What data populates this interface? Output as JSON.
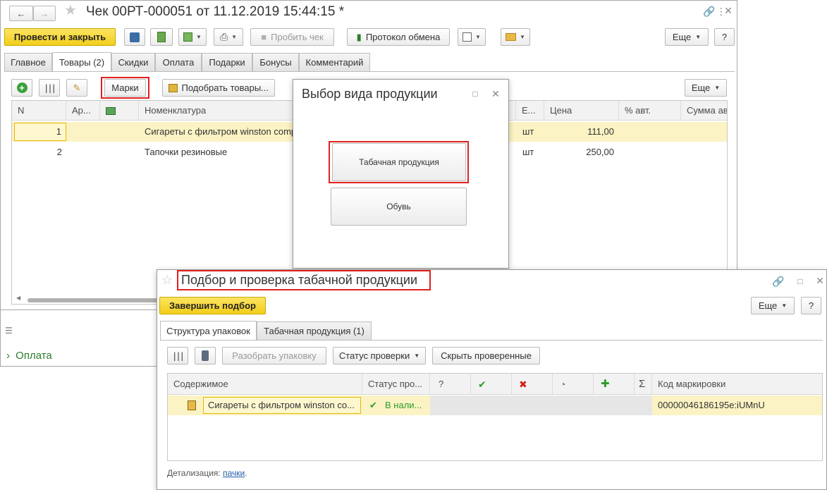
{
  "main_window": {
    "title": "Чек 00РТ-000051 от 11.12.2019 15:44:15 *",
    "nav_back": "←",
    "nav_forward": "→",
    "toolbar": {
      "post_close": "Провести и закрыть",
      "punch_receipt": "Пробить чек",
      "exchange_log": "Протокол обмена",
      "more": "Еще",
      "help": "?"
    },
    "tabs": [
      "Главное",
      "Товары (2)",
      "Скидки",
      "Оплата",
      "Подарки",
      "Бонусы",
      "Комментарий"
    ],
    "goods_toolbar": {
      "marks": "Марки",
      "select_goods": "Подобрать товары...",
      "more": "Еще"
    },
    "columns": [
      "N",
      "Ар...",
      "",
      "Номенклатура",
      "Е...",
      "Цена",
      "% авт.",
      "Сумма ав"
    ],
    "rows": [
      {
        "n": "1",
        "name": "Сигареты с фильтром winston comp",
        "unit": "шт",
        "price": "111,00"
      },
      {
        "n": "2",
        "name": "Тапочки резиновые",
        "unit": "шт",
        "price": "250,00"
      }
    ],
    "payment_link": "Оплата"
  },
  "dialog_product_type": {
    "title": "Выбор вида продукции",
    "options": [
      "Табачная продукция",
      "Обувь"
    ]
  },
  "tobacco_window": {
    "title": "Подбор и проверка табачной продукции",
    "finish": "Завершить подбор",
    "more": "Еще",
    "help": "?",
    "tabs": [
      "Структура упаковок",
      "Табачная продукция (1)"
    ],
    "toolbar": {
      "unpack": "Разобрать упаковку",
      "check_status": "Статус проверки",
      "hide_checked": "Скрыть проверенные"
    },
    "columns": {
      "content": "Содержимое",
      "status": "Статус про...",
      "question": "?",
      "sigma": "Σ",
      "code": "Код маркировки"
    },
    "row": {
      "content": "Сигареты с фильтром winston co...",
      "status": "В нали...",
      "code": "00000046186195e:iUMnU"
    },
    "detail_label": "Детализация:",
    "detail_link": "пачки",
    "detail_end": "."
  },
  "colors": {
    "accent_yellow": "#f2ce1a",
    "selection": "#fbf3c3",
    "highlight_red": "#e02020",
    "ok_green": "#2a9d2a",
    "error_red": "#d22020"
  }
}
